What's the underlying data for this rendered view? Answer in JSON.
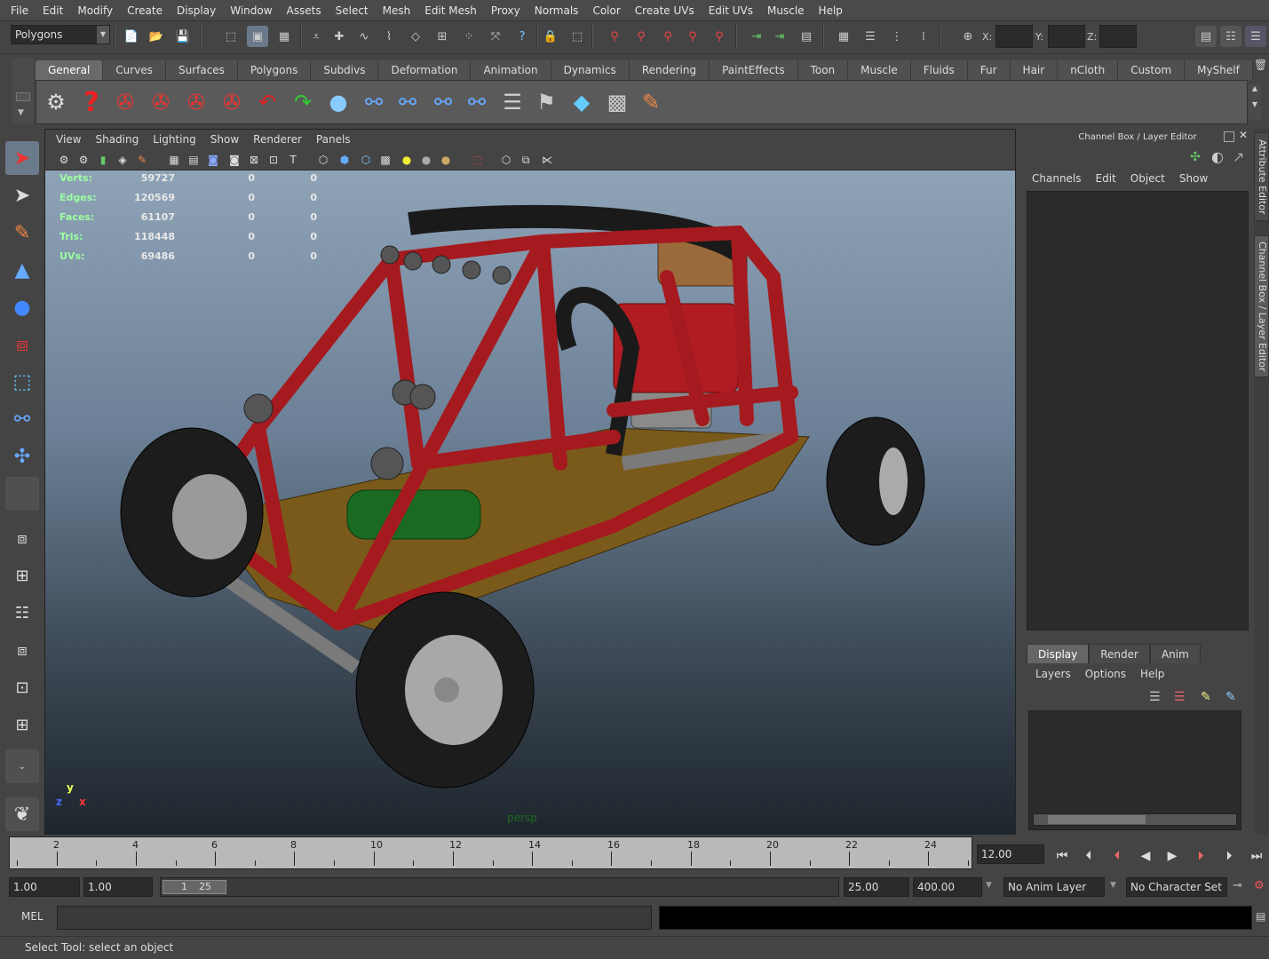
{
  "menubar": [
    "File",
    "Edit",
    "Modify",
    "Create",
    "Display",
    "Window",
    "Assets",
    "Select",
    "Mesh",
    "Edit Mesh",
    "Proxy",
    "Normals",
    "Color",
    "Create UVs",
    "Edit UVs",
    "Muscle",
    "Help"
  ],
  "statusline": {
    "mode": "Polygons",
    "x_label": "X:",
    "y_label": "Y:",
    "z_label": "Z:"
  },
  "shelf": {
    "tabs": [
      "General",
      "Curves",
      "Surfaces",
      "Polygons",
      "Subdivs",
      "Deformation",
      "Animation",
      "Dynamics",
      "Rendering",
      "PaintEffects",
      "Toon",
      "Muscle",
      "Fluids",
      "Fur",
      "Hair",
      "nCloth",
      "Custom",
      "MyShelf"
    ],
    "active_tab": "General"
  },
  "viewport": {
    "menu": [
      "View",
      "Shading",
      "Lighting",
      "Show",
      "Renderer",
      "Panels"
    ],
    "camera": "persp",
    "axis": {
      "y": "y",
      "z": "z",
      "x": "x"
    },
    "hud": [
      {
        "label": "Verts:",
        "value": "59727",
        "sel": "0",
        "comp": "0"
      },
      {
        "label": "Edges:",
        "value": "120569",
        "sel": "0",
        "comp": "0"
      },
      {
        "label": "Faces:",
        "value": "61107",
        "sel": "0",
        "comp": "0"
      },
      {
        "label": "Tris:",
        "value": "118448",
        "sel": "0",
        "comp": "0"
      },
      {
        "label": "UVs:",
        "value": "69486",
        "sel": "0",
        "comp": "0"
      }
    ]
  },
  "channel_box": {
    "title": "Channel Box / Layer Editor",
    "menu": [
      "Channels",
      "Edit",
      "Object",
      "Show"
    ]
  },
  "layer_editor": {
    "tabs": [
      "Display",
      "Render",
      "Anim"
    ],
    "active_tab": "Display",
    "menu": [
      "Layers",
      "Options",
      "Help"
    ]
  },
  "side_tabs": [
    "Attribute Editor",
    "Channel Box / Layer Editor"
  ],
  "timeline": {
    "labels": [
      "2",
      "4",
      "6",
      "8",
      "10",
      "12",
      "14",
      "16",
      "18",
      "20",
      "22",
      "24"
    ],
    "current_frame": "12.00"
  },
  "range": {
    "start": "1.00",
    "playback_start": "1.00",
    "range_min": "1",
    "range_max": "25",
    "playback_end": "25.00",
    "end": "400.00",
    "anim_layer": "No Anim Layer",
    "character_set": "No Character Set"
  },
  "command_line": {
    "label": "MEL"
  },
  "help_line": "Select Tool: select an object"
}
